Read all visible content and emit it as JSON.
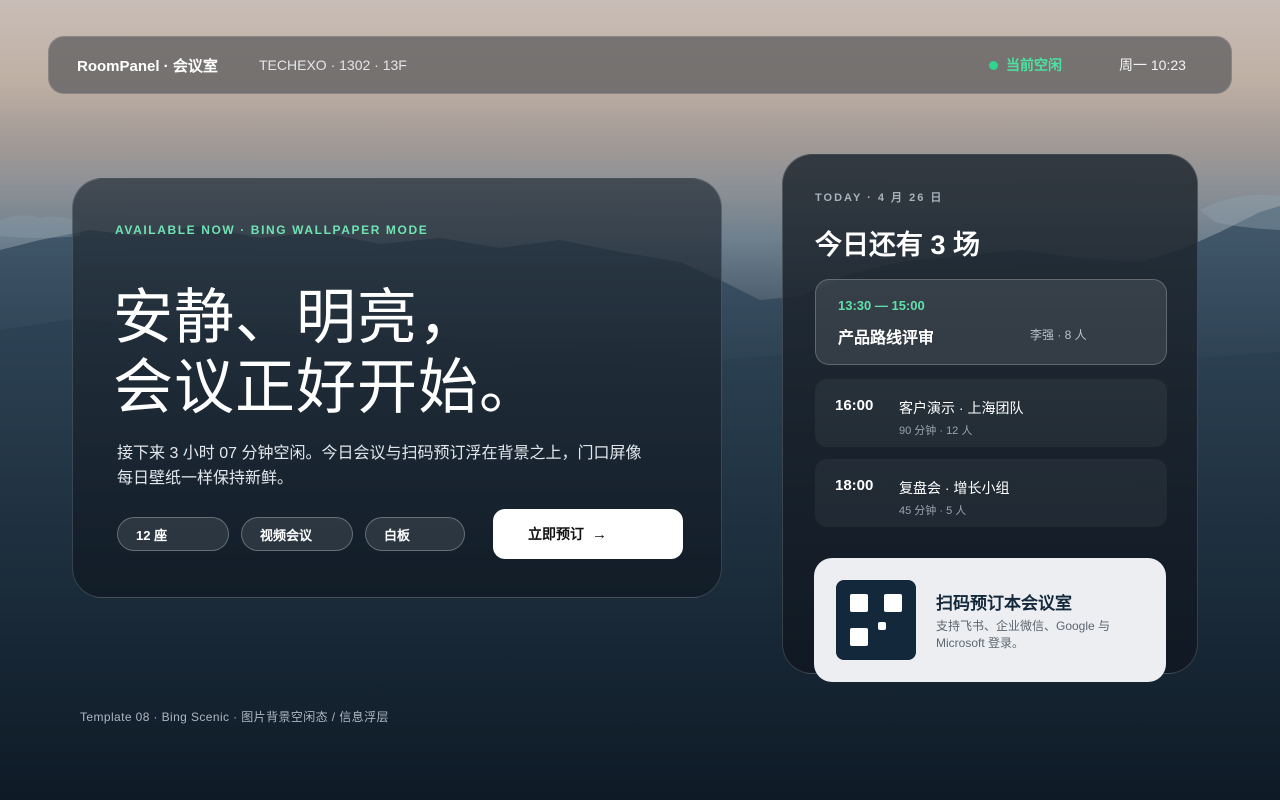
{
  "topbar": {
    "brand": "RoomPanel · 会议室",
    "location": "TECHEXO · 1302 · 13F",
    "status": "当前空闲",
    "clock": "周一 10:23"
  },
  "hero": {
    "eyebrow": "AVAILABLE NOW · BING WALLPAPER MODE",
    "headline": "安静、明亮，\n会议正好开始。",
    "description": "接下来 3 小时 07 分钟空闲。今日会议与扫码预订浮在背景之上，门口屏像每日壁纸一样保持新鲜。",
    "chips": [
      "12 座",
      "视频会议",
      "白板"
    ],
    "book_button": "立即预订",
    "book_arrow": "→"
  },
  "schedule": {
    "date_label": "TODAY · 4 月 26 日",
    "remaining": "今日还有 3 场",
    "current": {
      "time": "13:30 — 15:00",
      "title": "产品路线评审",
      "meta": "李强 · 8 人"
    },
    "upcoming": [
      {
        "time": "16:00",
        "title": "客户演示 · 上海团队",
        "meta": "90 分钟 · 12 人"
      },
      {
        "time": "18:00",
        "title": "复盘会 · 增长小组",
        "meta": "45 分钟 · 5 人"
      }
    ]
  },
  "qr_card": {
    "title": "扫码预订本会议室",
    "description": "支持飞书、企业微信、Google 与 Microsoft 登录。",
    "icon": "qr-code-icon"
  },
  "footer": "Template 08 · Bing Scenic · 图片背景空闲态 / 信息浮层",
  "colors": {
    "accent_green": "#5fe0a8",
    "status_green": "#2fd58a",
    "qr_dark": "#14283c"
  }
}
